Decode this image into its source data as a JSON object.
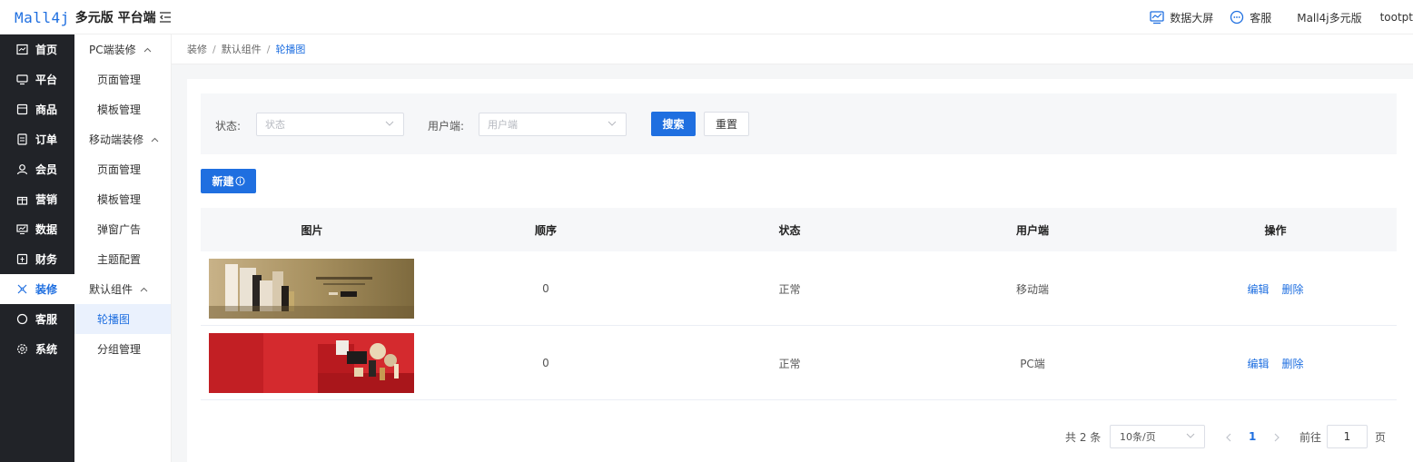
{
  "header": {
    "brand": "Mall4j",
    "subtitle": "多元版 平台端",
    "screen_label": "数据大屏",
    "service_label": "客服",
    "shop_label": "Mall4j多元版",
    "user_label": "tootpt"
  },
  "nav1": [
    {
      "label": "首页",
      "icon": "home-icon"
    },
    {
      "label": "平台",
      "icon": "platform-icon"
    },
    {
      "label": "商品",
      "icon": "goods-icon"
    },
    {
      "label": "订单",
      "icon": "order-icon"
    },
    {
      "label": "会员",
      "icon": "member-icon"
    },
    {
      "label": "营销",
      "icon": "gift-icon"
    },
    {
      "label": "数据",
      "icon": "data-icon"
    },
    {
      "label": "财务",
      "icon": "finance-icon"
    },
    {
      "label": "装修",
      "icon": "decor-icon"
    },
    {
      "label": "客服",
      "icon": "chat-icon"
    },
    {
      "label": "系统",
      "icon": "gear-icon"
    }
  ],
  "nav2": {
    "pc_group": "PC端装修",
    "pc_items": [
      "页面管理",
      "模板管理"
    ],
    "mobile_group": "移动端装修",
    "mobile_items": [
      "页面管理",
      "模板管理",
      "弹窗广告",
      "主题配置"
    ],
    "default_group": "默认组件",
    "default_items": [
      "轮播图",
      "分组管理"
    ]
  },
  "breadcrumb": [
    "装修",
    "默认组件",
    "轮播图"
  ],
  "breadcrumb_sep": "/",
  "filter": {
    "status_label": "状态:",
    "status_placeholder": "状态",
    "client_label": "用户端:",
    "client_placeholder": "用户端",
    "search_btn": "搜索",
    "reset_btn": "重置"
  },
  "new_btn": "新建",
  "table": {
    "headers": [
      "图片",
      "顺序",
      "状态",
      "用户端",
      "操作"
    ],
    "rows": [
      {
        "order": "0",
        "status": "正常",
        "client": "移动端",
        "edit": "编辑",
        "delete": "删除"
      },
      {
        "order": "0",
        "status": "正常",
        "client": "PC端",
        "edit": "编辑",
        "delete": "删除"
      }
    ]
  },
  "pagination": {
    "total": "共 2 条",
    "page_size": "10条/页",
    "current_page": "1",
    "goto_label": "前往",
    "goto_value": "1",
    "page_suffix": "页"
  },
  "colors": {
    "primary": "#1f6fe0",
    "sidebar": "#212328"
  }
}
